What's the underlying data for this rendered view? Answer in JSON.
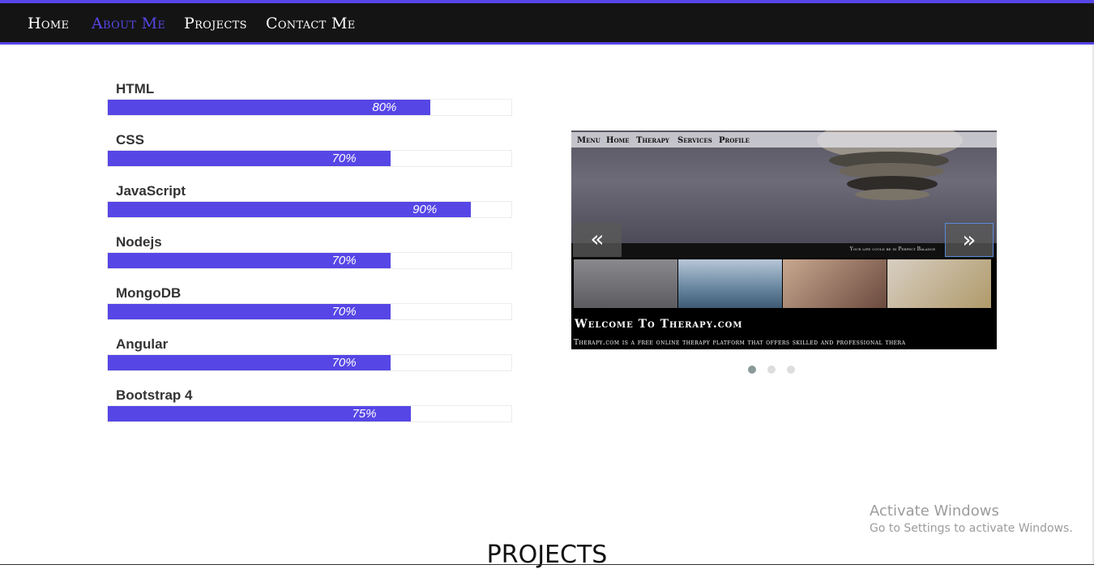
{
  "nav": {
    "items": [
      {
        "label": "Home"
      },
      {
        "label": "About Me"
      },
      {
        "label": "Projects"
      },
      {
        "label": "Contact Me"
      }
    ],
    "active_index": 1
  },
  "skills": [
    {
      "name": "HTML",
      "percent_label": "80%",
      "percent": 80
    },
    {
      "name": "CSS",
      "percent_label": "70%",
      "percent": 70
    },
    {
      "name": "JavaScript",
      "percent_label": "90%",
      "percent": 90
    },
    {
      "name": "Nodejs",
      "percent_label": "70%",
      "percent": 70
    },
    {
      "name": "MongoDB",
      "percent_label": "70%",
      "percent": 70
    },
    {
      "name": "Angular",
      "percent_label": "70%",
      "percent": 70
    },
    {
      "name": "Bootstrap 4",
      "percent_label": "75%",
      "percent": 75
    }
  ],
  "carousel": {
    "slide": {
      "menu_links": [
        "Menu",
        "Home",
        "Therapy",
        "Services",
        "Profile"
      ],
      "tagline": "Your life could be in Perfect Balance",
      "welcome": "Welcome To Therapy.com",
      "description": "Therapy.com is a free online therapy platform that offers skilled and professional thera"
    },
    "prev_icon": "chevron-double-left-icon",
    "next_icon": "chevron-double-right-icon",
    "prev_glyph": "«",
    "next_glyph": "»",
    "indicator_count": 3,
    "active_indicator": 0
  },
  "watermark": {
    "title": "Activate Windows",
    "subtitle": "Go to Settings to activate Windows."
  },
  "projects": {
    "heading": "PROJECTS"
  },
  "colors": {
    "accent": "#5646e6",
    "navbar_bg": "#141414"
  }
}
